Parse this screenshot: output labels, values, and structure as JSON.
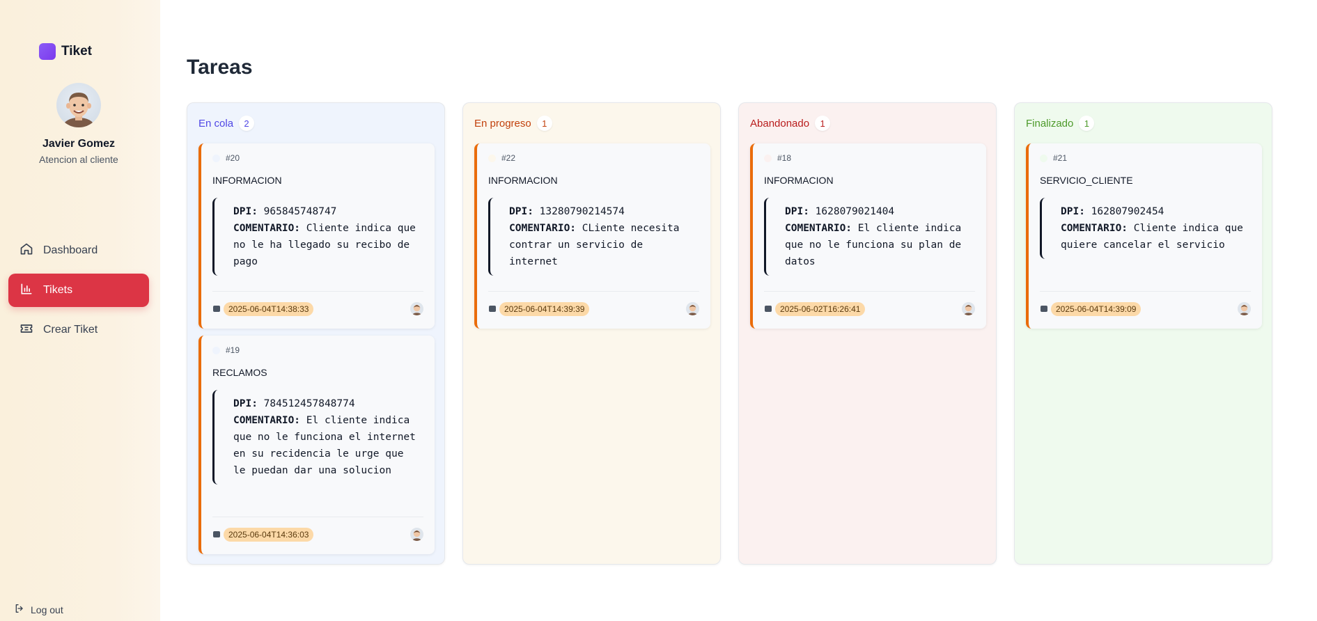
{
  "app": {
    "name": "Tiket",
    "logo_color": "#7c3aed"
  },
  "user": {
    "name": "Javier Gomez",
    "role": "Atencion al cliente"
  },
  "nav": {
    "items": [
      {
        "label": "Dashboard",
        "icon": "home-icon"
      },
      {
        "label": "Tikets",
        "icon": "bar-chart-icon",
        "active": true
      },
      {
        "label": "Crear Tiket",
        "icon": "ticket-icon"
      }
    ],
    "logout_label": "Log out"
  },
  "page": {
    "title": "Tareas"
  },
  "columns": [
    {
      "title": "En cola",
      "count": "2",
      "color": "#4f46e5",
      "bg": "#eff4fd",
      "cards": [
        {
          "id": "#20",
          "category": "INFORMACION",
          "dpi_label": "DPI:",
          "dpi": "965845748747",
          "comment_label": "COMENTARIO:",
          "comment": "Cliente indica que no le ha llegado su recibo de pago",
          "date": "2025-06-04T14:38:33"
        },
        {
          "id": "#19",
          "category": "RECLAMOS",
          "dpi_label": "DPI:",
          "dpi": "784512457848774",
          "comment_label": "COMENTARIO:",
          "comment": "El cliente indica que no le funciona el internet en su recidencia le urge que le puedan dar una solucion",
          "date": "2025-06-04T14:36:03"
        }
      ]
    },
    {
      "title": "En progreso",
      "count": "1",
      "color": "#c2410c",
      "bg": "#fcf7ec",
      "cards": [
        {
          "id": "#22",
          "category": "INFORMACION",
          "dpi_label": "DPI:",
          "dpi": "13280790214574",
          "comment_label": "COMENTARIO:",
          "comment": "CLiente necesita contrar un servicio de internet",
          "date": "2025-06-04T14:39:39"
        }
      ]
    },
    {
      "title": "Abandonado",
      "count": "1",
      "color": "#b91c1c",
      "bg": "#fbf1f0",
      "cards": [
        {
          "id": "#18",
          "category": "INFORMACION",
          "dpi_label": "DPI:",
          "dpi": "1628079021404",
          "comment_label": "COMENTARIO:",
          "comment": "El cliente indica que no le funciona su plan de datos",
          "date": "2025-06-02T16:26:41"
        }
      ]
    },
    {
      "title": "Finalizado",
      "count": "1",
      "color": "#4d9a2a",
      "bg": "#effaee",
      "cards": [
        {
          "id": "#21",
          "category": "SERVICIO_CLIENTE",
          "dpi_label": "DPI:",
          "dpi": "162807902454",
          "comment_label": "COMENTARIO:",
          "comment": "Cliente indica que quiere cancelar el servicio",
          "date": "2025-06-04T14:39:09"
        }
      ]
    }
  ]
}
